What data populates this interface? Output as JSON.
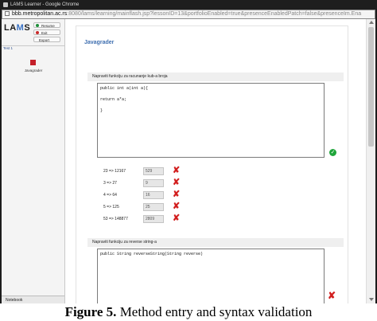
{
  "window": {
    "title": "LAMS Learner - Google Chrome",
    "url_host": "bbb.metropolitan.ac.rs",
    "url_rest": ":8080/lams/learning/mainflash.jsp?lessonID=13&portfolioEnabled=true&presenceEnabledPatch=false&presenceIm.Ena"
  },
  "sidebar": {
    "logo_main": "LA",
    "logo_accent": "M",
    "logo_end": "S",
    "resume_label": "Resume",
    "exit_label": "Exit",
    "export_label": "Export",
    "tree_label": "Test 1",
    "activity_name": "Javagrader",
    "notebook_label": "Notebook",
    "activity_color": "#c4202a"
  },
  "main": {
    "activity_title": "Javagrader",
    "task1": {
      "prompt": "Napraviti funkciju za racunanje kub-a broja",
      "code_lines": [
        "public int a(int a){",
        "",
        "return a*a;",
        "",
        "}"
      ]
    },
    "tests": [
      {
        "expr": "23 => 12167",
        "value": "529"
      },
      {
        "expr": "3 => 27",
        "value": "9"
      },
      {
        "expr": "4 => 64",
        "value": "16"
      },
      {
        "expr": "5 => 125",
        "value": "25"
      },
      {
        "expr": "53 => 148877",
        "value": "2809"
      }
    ],
    "task2": {
      "prompt": "Napraviti funkciju za reverse string-a",
      "code_lines": [
        "public String reverseString(String reverse)"
      ]
    },
    "icons": {
      "ok": "check-circle-icon",
      "fail": "x-mark-icon"
    },
    "colors": {
      "ok": "#1fa53a",
      "fail": "#d21f1f",
      "title": "#3f6fb0"
    }
  },
  "caption": {
    "label": "Figure 5.",
    "text": "Method entry and syntax validation"
  }
}
